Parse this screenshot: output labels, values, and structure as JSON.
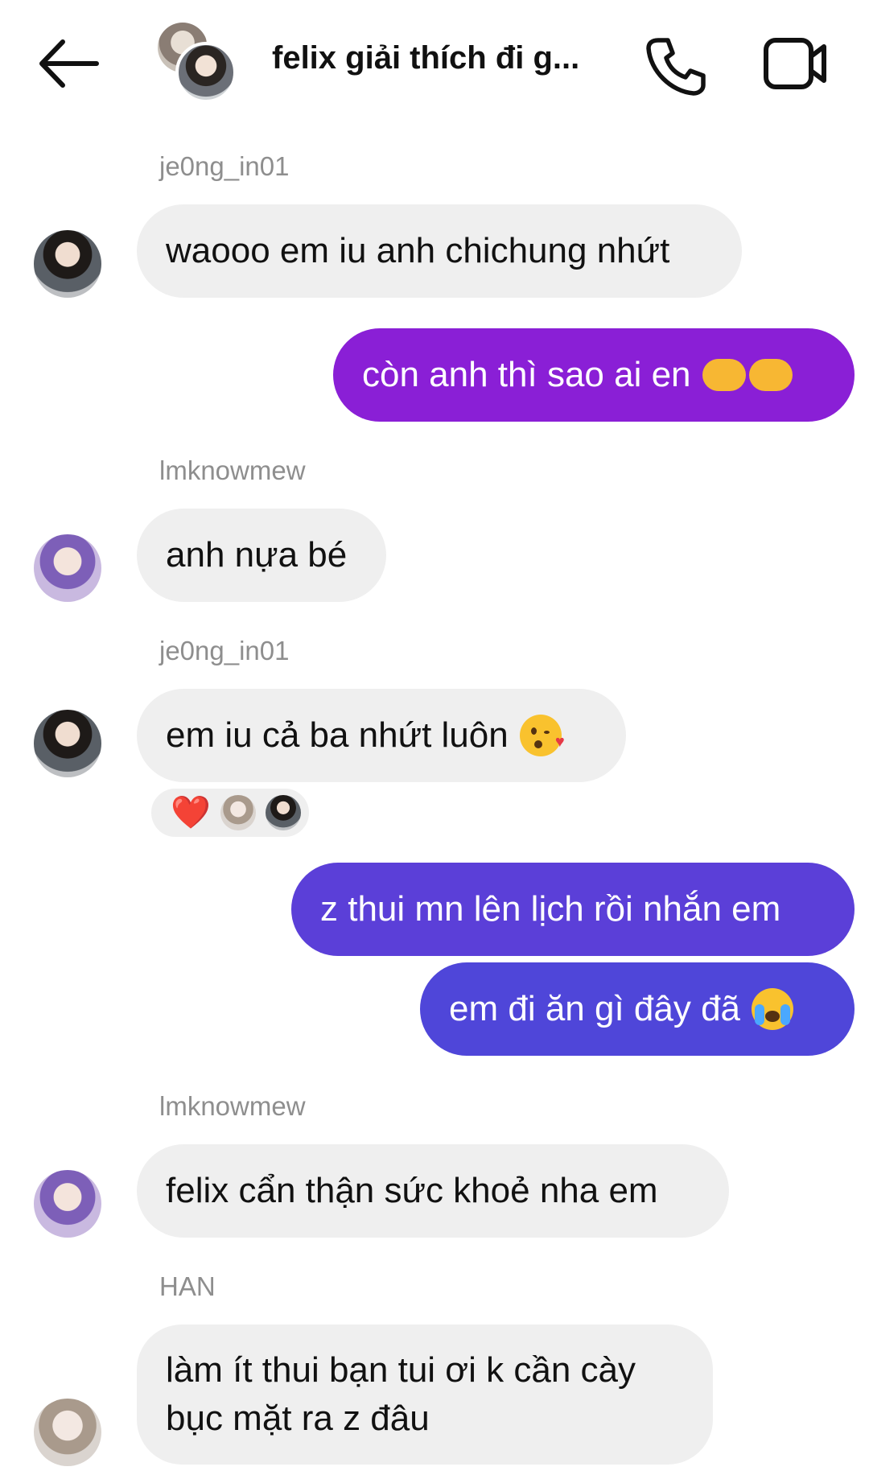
{
  "header": {
    "chat_title": "felix giải thích đi g...",
    "back_icon": "arrow-left-icon",
    "call_icon": "phone-icon",
    "video_icon": "video-camera-icon"
  },
  "messages": [
    {
      "sender": "je0ng_in01",
      "text": "waooo em iu anh chichung nhứt",
      "direction": "incoming"
    },
    {
      "text": "còn anh thì sao ai en",
      "emoji": "pointing-hands",
      "direction": "outgoing"
    },
    {
      "sender": "lmknowmew",
      "text": "anh nựa bé",
      "direction": "incoming"
    },
    {
      "sender": "je0ng_in01",
      "text": "em iu cả ba nhứt luôn",
      "emoji": "kissing-face-heart",
      "direction": "incoming",
      "reactions": {
        "emoji": "❤️",
        "reactor_avatars": 2
      }
    },
    {
      "text": "z thui mn lên lịch rồi nhắn em",
      "direction": "outgoing"
    },
    {
      "text": "em đi ăn gì đây đã",
      "emoji": "loudly-crying-face",
      "direction": "outgoing"
    },
    {
      "sender": "lmknowmew",
      "text": "felix cẩn thận sức khoẻ nha em",
      "direction": "incoming"
    },
    {
      "sender": "HAN",
      "text_line1": "làm ít thui bạn tui ơi k cần cày",
      "text_line2": "bục mặt ra z đâu",
      "direction": "incoming"
    }
  ],
  "colors": {
    "outgoing_purple": "#8a1fd6",
    "outgoing_indigo_top": "#5b3fd8",
    "outgoing_indigo": "#4f46d9",
    "incoming_bg": "#efefef",
    "sender_text": "#8e8e8e"
  }
}
